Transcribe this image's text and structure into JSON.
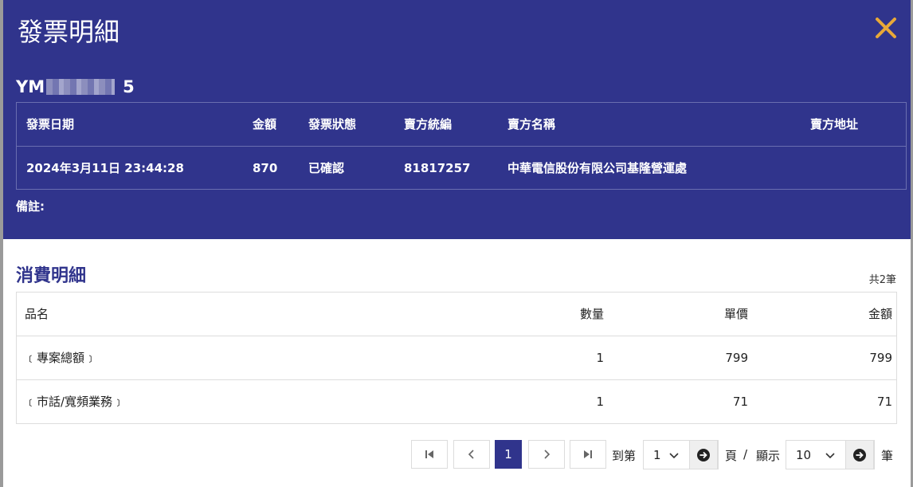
{
  "modal": {
    "title": "發票明細",
    "invoice_number_prefix": "YM",
    "invoice_number_suffix": "5",
    "close_color": "#e8a838",
    "header_color": "#30348c"
  },
  "invoice_table": {
    "headers": {
      "date": "發票日期",
      "amount": "金額",
      "status": "發票狀態",
      "seller_tax_id": "賣方統編",
      "seller_name": "賣方名稱",
      "seller_address": "賣方地址"
    },
    "row": {
      "date": "2024年3月11日 23:44:28",
      "amount": "870",
      "status": "已確認",
      "seller_tax_id": "81817257",
      "seller_name": "中華電信股份有限公司基隆營運處",
      "seller_address": ""
    }
  },
  "remark_label": "備註:",
  "details": {
    "title": "消費明細",
    "total_count": "共2筆",
    "headers": {
      "name": "品名",
      "qty": "數量",
      "unit_price": "單價",
      "amount": "金額"
    },
    "rows": [
      {
        "name": "﹝專案總額﹞",
        "qty": "1",
        "unit_price": "799",
        "amount": "799"
      },
      {
        "name": "﹝市話/寬頻業務﹞",
        "qty": "1",
        "unit_price": "71",
        "amount": "71"
      }
    ]
  },
  "pagination": {
    "current_page": "1",
    "goto_label": "到第",
    "page_select_value": "1",
    "page_label": "頁",
    "separator": "/",
    "show_label": "顯示",
    "page_size_value": "10",
    "records_label": "筆"
  }
}
